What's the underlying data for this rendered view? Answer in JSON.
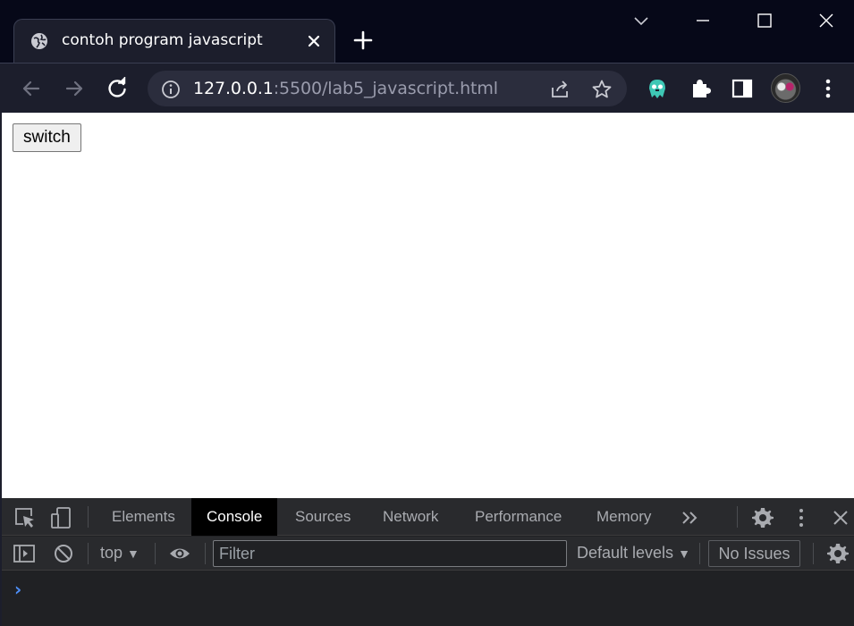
{
  "browser": {
    "tab_title": "contoh program javascript",
    "url_host": "127.0.0.1",
    "url_rest": ":5500/lab5_javascript.html",
    "icons": {
      "favicon": "globe-icon",
      "close_tab": "close-icon",
      "new_tab": "plus-icon",
      "tab_search": "chevron-down-icon",
      "minimize": "minimize-icon",
      "maximize": "maximize-icon",
      "close_window": "close-icon",
      "back": "back-arrow-icon",
      "forward": "forward-arrow-icon",
      "reload": "reload-icon",
      "site_info": "info-icon",
      "share": "share-icon",
      "bookmark": "star-icon",
      "extension": "ghost-extension-icon",
      "extensions": "puzzle-icon",
      "side_panel": "side-panel-icon",
      "profile": "avatar"
    }
  },
  "page": {
    "switch_label": "switch"
  },
  "devtools": {
    "tabs": [
      "Elements",
      "Console",
      "Sources",
      "Network",
      "Performance",
      "Memory"
    ],
    "active_tab": "Console",
    "context": "top",
    "filter_placeholder": "Filter",
    "levels": "Default levels",
    "issues": "No Issues",
    "prompt": "›"
  },
  "colors": {
    "titlebar": "#060818",
    "toolbar": "#1c1e2c",
    "omnibox": "#2b2d3d",
    "devtools_bg": "#202124",
    "devtools_bar": "#292a2d",
    "prompt": "#4d8ef7"
  }
}
